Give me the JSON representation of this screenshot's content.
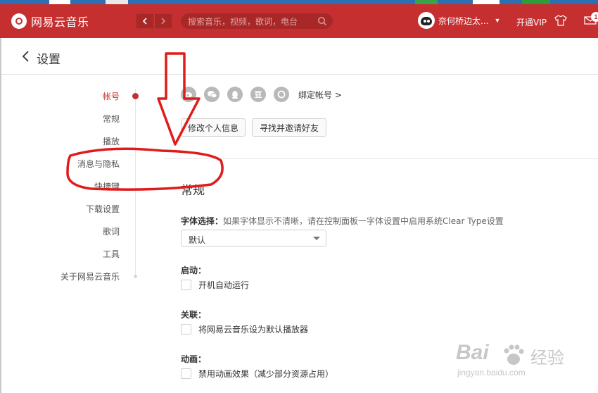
{
  "header": {
    "app_name": "网易云音乐",
    "search_placeholder": "搜索音乐，视频，歌词，电台",
    "user_name": "奈何桥边太...",
    "vip_label": "开通VIP",
    "mail_count": "1"
  },
  "page": {
    "title": "设置"
  },
  "sidebar": {
    "items": [
      {
        "label": "帐号",
        "active": true
      },
      {
        "label": "常规"
      },
      {
        "label": "播放"
      },
      {
        "label": "消息与隐私"
      },
      {
        "label": "快捷键"
      },
      {
        "label": "下载设置"
      },
      {
        "label": "歌词"
      },
      {
        "label": "工具"
      },
      {
        "label": "关于网易云音乐"
      }
    ]
  },
  "account": {
    "social_icons": [
      "weibo-icon",
      "wechat-icon",
      "qq-icon",
      "douban-icon",
      "netease-icon"
    ],
    "douban_glyph": "豆",
    "bind_label": "绑定帐号 >",
    "edit_profile_label": "修改个人信息",
    "find_friends_label": "寻找并邀请好友"
  },
  "general": {
    "title": "常规",
    "font_label": "字体选择：",
    "font_hint": "如果字体显示不清晰，请在控制面板一字体设置中启用系统Clear Type设置",
    "font_value": "默认",
    "startup_label": "启动：",
    "startup_option": "开机自动运行",
    "assoc_label": "关联：",
    "assoc_option": "将网易云音乐设为默认播放器",
    "anim_label": "动画：",
    "anim_option": "禁用动画效果（减少部分资源占用）"
  },
  "watermark": {
    "brand": "Bai",
    "brand_cn": "经验",
    "url": "jingyan.baidu.com"
  },
  "colors": {
    "brand_red": "#c62f2f",
    "annotation_red": "#e01b1b"
  }
}
